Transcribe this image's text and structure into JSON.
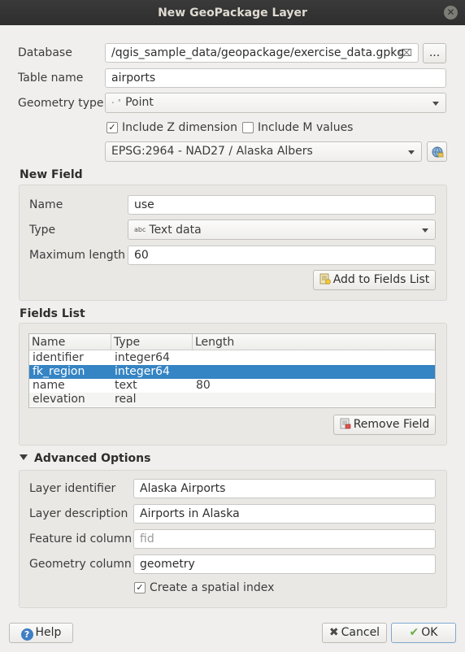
{
  "window": {
    "title": "New GeoPackage Layer"
  },
  "form": {
    "database_label": "Database",
    "database_value": "/qgis_sample_data/geopackage/exercise_data.gpkg",
    "browse_label": "...",
    "table_name_label": "Table name",
    "table_name_value": "airports",
    "geometry_type_label": "Geometry type",
    "geometry_type_value": "Point",
    "include_z_label": "Include Z dimension",
    "include_z_checked": true,
    "include_m_label": "Include M values",
    "include_m_checked": false,
    "crs_value": "EPSG:2964 - NAD27 / Alaska Albers"
  },
  "new_field": {
    "title": "New Field",
    "name_label": "Name",
    "name_value": "use",
    "type_label": "Type",
    "type_prefix": "abc",
    "type_value": "Text data",
    "max_length_label": "Maximum length",
    "max_length_value": "60",
    "add_button": "Add to Fields List"
  },
  "fields_list": {
    "title": "Fields List",
    "columns": [
      "Name",
      "Type",
      "Length"
    ],
    "rows": [
      {
        "name": "identifier",
        "type": "integer64",
        "length": ""
      },
      {
        "name": "fk_region",
        "type": "integer64",
        "length": ""
      },
      {
        "name": "name",
        "type": "text",
        "length": "80"
      },
      {
        "name": "elevation",
        "type": "real",
        "length": ""
      }
    ],
    "selected_row": 1,
    "remove_button": "Remove Field"
  },
  "advanced": {
    "title": "Advanced Options",
    "layer_identifier_label": "Layer identifier",
    "layer_identifier_value": "Alaska Airports",
    "layer_description_label": "Layer description",
    "layer_description_value": "Airports in Alaska",
    "feature_id_label": "Feature id column",
    "feature_id_placeholder": "fid",
    "geometry_column_label": "Geometry column",
    "geometry_column_value": "geometry",
    "spatial_index_label": "Create a spatial index",
    "spatial_index_checked": true
  },
  "buttons": {
    "help": "Help",
    "cancel": "Cancel",
    "ok": "OK"
  },
  "colors": {
    "selection": "#3584c4",
    "titlebar": "#2e2e2e",
    "ok_border": "#7fa7d0"
  }
}
